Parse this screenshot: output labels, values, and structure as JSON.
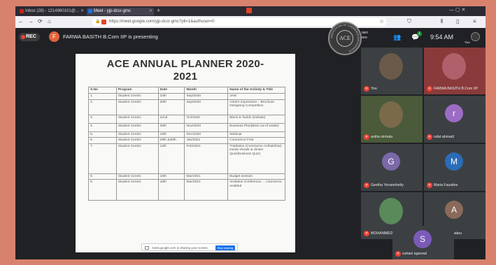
{
  "browser": {
    "tabs": [
      {
        "label": "Inbox (28) - 1214980101@...",
        "color": "#c5221f"
      },
      {
        "label": "Meet - yjp-dcsr-gmc",
        "color": "#1a73e8",
        "active": true
      }
    ],
    "new_tab": "+",
    "window_controls": "— ▢ ✕",
    "url": "https://meet.google.com/yjp-dcsr-gmc?pli=1&authuser=0",
    "nav": {
      "back": "←",
      "forward": "→",
      "reload": "⟳",
      "home": "⌂"
    },
    "toolbar_icons": {
      "star": "☆",
      "shield": "⛉",
      "library": "⫴",
      "sidebar": "▯",
      "menu": "≡"
    }
  },
  "meet": {
    "rec_label": "REC",
    "presenter_initial": "F",
    "presenter_text": "FARWA BASITH B.Com IIP is presenting",
    "join_initial": "A",
    "join_text_1": "Akshitha rani",
    "join_text_2": "and 80 more",
    "people_icon": "👥",
    "chat_icon": "💬",
    "chat_count": "1",
    "clock": "9:54 AM",
    "you_label": "You"
  },
  "slide": {
    "title_1": "ACE ANNUAL PLANNER 2020-",
    "title_2": "2021",
    "headers": [
      "S.No",
      "Program",
      "Date",
      "Month",
      "Name of the Activity & Title"
    ],
    "rows": [
      [
        "1.",
        "Student Centric",
        "24th",
        "Sep/2020",
        "JAM"
      ],
      [
        "2.",
        "Student Centric",
        "30th",
        "Sep/2020",
        "Artist's Impression – Brochure Designing Competition"
      ],
      [
        "3.",
        "Student Centric",
        "22nd",
        "Oct/2020",
        "Block & Tackle (Debate)"
      ],
      [
        "4.",
        "Student Centric",
        "20th",
        "Nov/2020",
        "Business Plan(Best out of waste)"
      ],
      [
        "5.",
        "Student Centric",
        "18th",
        "Dec/2020",
        "Webinar"
      ],
      [
        "6.",
        "Student Centric",
        "29th &30th",
        "Jan/2021",
        "Commerce Fest"
      ],
      [
        "7.",
        "Student Centric",
        "12th",
        "Feb/2021",
        "Triathalon (Commerce Anthakshari, Dumb shrads & clicker Quiz(Business Quiz)"
      ],
      [
        "8.",
        "Student Centric",
        "10th",
        "Mar/2021",
        "Budget session"
      ],
      [
        "9.",
        "Student Centric",
        "18th",
        "Mar/2021",
        "Invitation Conference ... commerce enabled"
      ]
    ],
    "share_text": "meet.google.com is sharing your screen.",
    "stop_sharing": "Stop sharing"
  },
  "logo": {
    "text": "ACE",
    "ring_text": "ASSOCIATION OF COMMERCE ENTHUSIASTS"
  },
  "participants": [
    {
      "name": "You",
      "initial": "",
      "color": "#3c4043",
      "photo": true,
      "photo_color": "#6b5a4a"
    },
    {
      "name": "FARWA BASITH B.Com IIP",
      "initial": "",
      "color": "#8a3a3a",
      "photo": true,
      "photo_color": "#b0606a"
    },
    {
      "name": "aniha nirmala",
      "initial": "",
      "color": "#4a5a3a",
      "photo": true,
      "photo_color": "#7a6a4a"
    },
    {
      "name": "rafat ahmadi",
      "initial": "r",
      "color": "#9c6cc4"
    },
    {
      "name": "Geetha Yeramshetty",
      "initial": "G",
      "color": "#7a68a8"
    },
    {
      "name": "Maria Faustina",
      "initial": "M",
      "color": "#2b6cb8"
    },
    {
      "name": "MOHAMMED KABIR AH...",
      "initial": "",
      "color": "#3c4043",
      "photo": true,
      "photo_color": "#5a8a5a"
    },
    {
      "name": "Aashrita Bandaru",
      "initial": "A",
      "color": "#8a6a5a"
    },
    {
      "name": "suhani agarwal",
      "initial": "S",
      "color": "#7a5ab8"
    }
  ]
}
